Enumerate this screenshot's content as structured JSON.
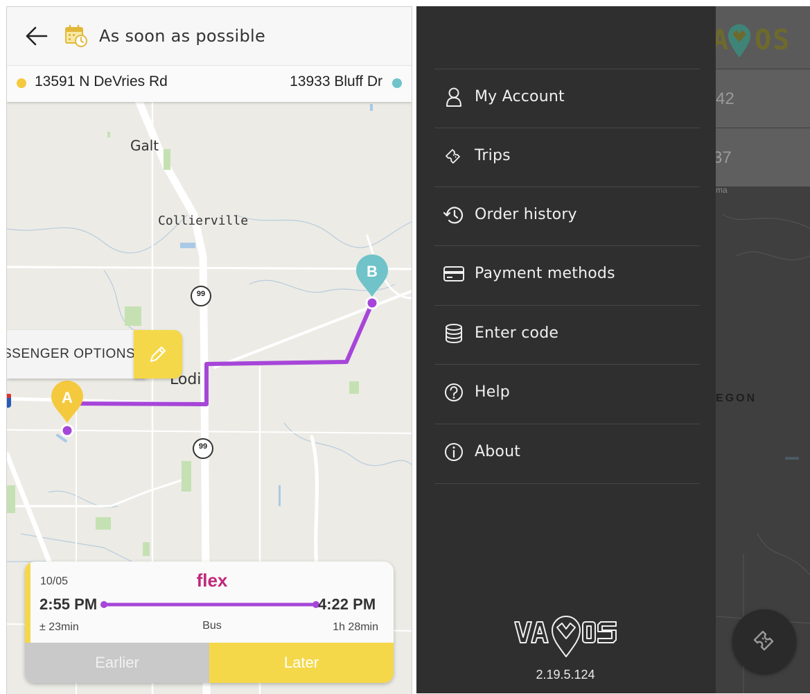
{
  "header": {
    "schedule_label": "As soon as possible",
    "from_address": "13591 N DeVries Rd",
    "to_address": "13933 Bluff Dr"
  },
  "map": {
    "labels": {
      "galt": "Galt",
      "collierville": "Collierville",
      "lodi": "Lodi",
      "hwy1": "99",
      "hwy2": "99"
    },
    "pin_a": "A",
    "pin_b": "B"
  },
  "passenger_options": {
    "label": "SSENGER OPTIONS"
  },
  "trip_card": {
    "date": "10/05",
    "service": "flex",
    "departure": "2:55 PM",
    "arrival": "4:22 PM",
    "departure_variance": "± 23min",
    "mode": "Bus",
    "duration": "1h 28min",
    "earlier_label": "Earlier",
    "later_label": "Later"
  },
  "drawer": {
    "items": [
      {
        "label": "My Account",
        "icon": "person-icon"
      },
      {
        "label": "Trips",
        "icon": "ticket-icon"
      },
      {
        "label": "Order history",
        "icon": "history-icon"
      },
      {
        "label": "Payment methods",
        "icon": "card-icon"
      },
      {
        "label": "Enter code",
        "icon": "database-icon"
      },
      {
        "label": "Help",
        "icon": "help-icon"
      },
      {
        "label": "About",
        "icon": "info-icon"
      }
    ],
    "brand": "VAMOS",
    "version": "2.19.5.124"
  },
  "behind": {
    "brand": "VAMOS",
    "value1": "42",
    "value2": "37",
    "small_text": "ma",
    "region": "EGON"
  },
  "colors": {
    "accent_yellow": "#f5d84a",
    "route_purple": "#a646d8",
    "pin_b_teal": "#6fc3c9",
    "flex_magenta": "#c0287a",
    "drawer_bg": "#2f2f2f"
  }
}
